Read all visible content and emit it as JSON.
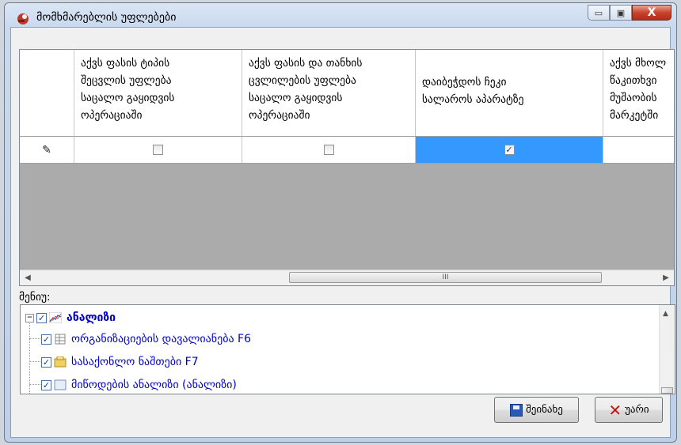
{
  "window": {
    "title": "მომხმარებლის უფლებები",
    "minimize_glyph": "▭",
    "maximize_glyph": "▣",
    "close_glyph": "X"
  },
  "grid": {
    "columns": [
      {
        "label": "აქვს ფასის ტიპის\nშეცვლის უფლება\nსაცალო გაყიდვის\nოპერაციაში"
      },
      {
        "label": "აქვს ფასის და თანხის\nცვლილების უფლება\nსაცალო გაყიდვის\nოპერაციაში"
      },
      {
        "label": "დაიბეჭდოს ჩეკი\nსალაროს აპარატზე"
      },
      {
        "label": "აქვს მხოლ\nწაკითხვი\nმუშაობის\nმარკეტში"
      }
    ],
    "row": {
      "indicator_icon": "pencil-icon",
      "values": [
        false,
        false,
        true,
        false
      ]
    },
    "scroll_thumb_glyph": "III"
  },
  "menu_label": "მენიუ:",
  "tree": {
    "items": [
      {
        "label": "ანალიზი",
        "checked": true,
        "icon": "chart-icon",
        "bold": true
      },
      {
        "label": "ორგანიზაციების დავალიანება   F6",
        "checked": true,
        "icon": "table-icon"
      },
      {
        "label": "სასაქონლო ნაშთები   F7",
        "checked": true,
        "icon": "box-icon"
      },
      {
        "label": "მიწოდების ანალიზი (ანალიზი)",
        "checked": true,
        "icon": "list-icon"
      }
    ]
  },
  "buttons": {
    "save_label": "შეინახე",
    "cancel_label": "უარი"
  },
  "colors": {
    "selected_cell": "#3399ff",
    "tree_text": "#0000cc"
  }
}
